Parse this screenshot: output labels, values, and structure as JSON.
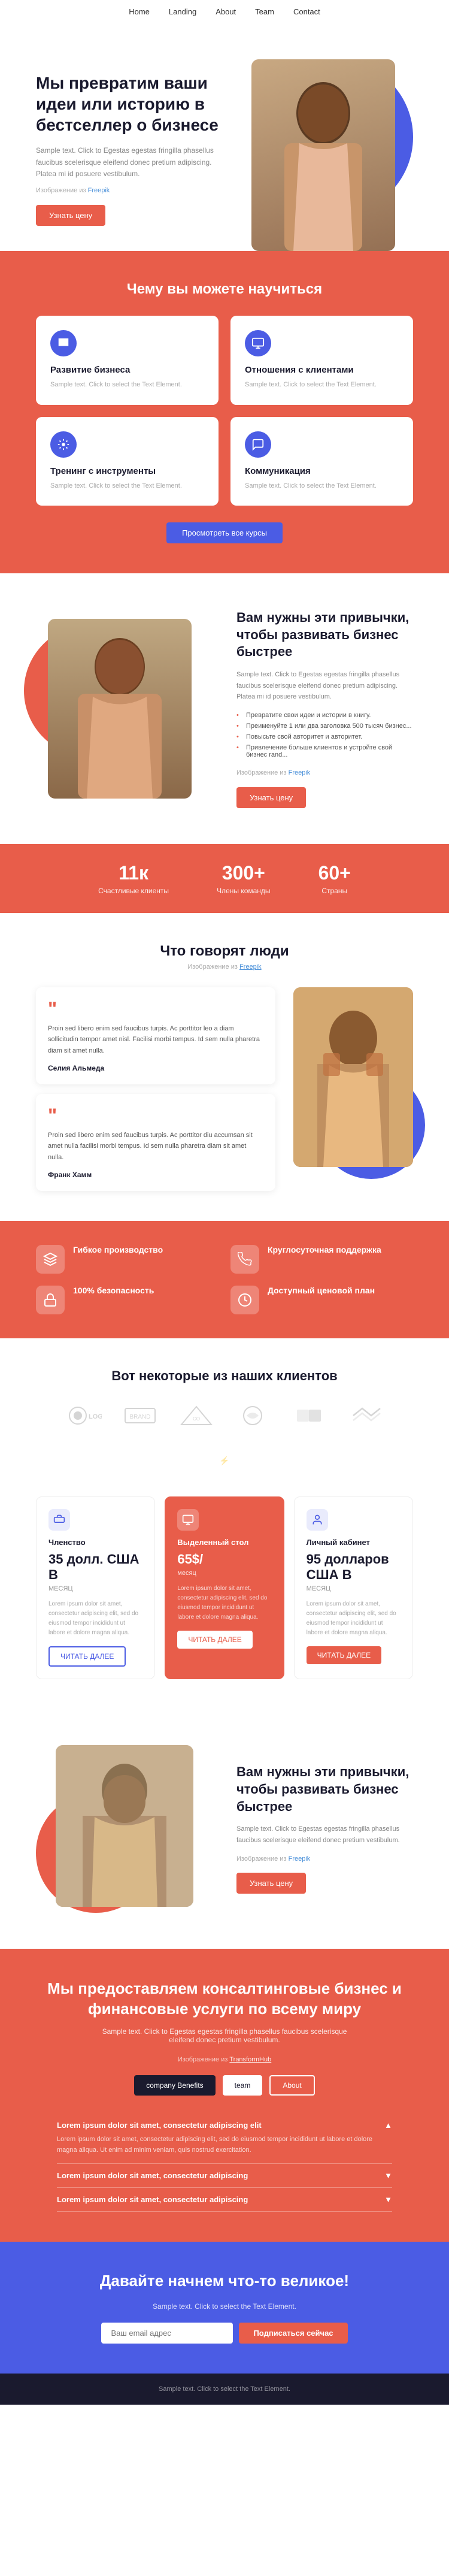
{
  "nav": {
    "links": [
      "Home",
      "Landing",
      "About",
      "Team",
      "Contact"
    ]
  },
  "hero": {
    "title": "Мы превратим ваши идеи или историю в бестселлер о бизнесе",
    "body": "Sample text. Click to Egestas egestas fringilla phasellus faucibus scelerisque eleifend donec pretium adipiscing. Platea mi id posuere vestibulum.",
    "img_credit": "Изображение из ",
    "img_credit_link": "Freepik",
    "btn_label": "Узнать цену"
  },
  "learn": {
    "title": "Чему вы можете научиться",
    "cards": [
      {
        "title": "Развитие бизнеса",
        "body": "Sample text. Click to select the Text Element."
      },
      {
        "title": "Отношения с клиентами",
        "body": "Sample text. Click to select the Text Element."
      },
      {
        "title": "Тренинг с инструменты",
        "body": "Sample text. Click to select the Text Element."
      },
      {
        "title": "Коммуникация",
        "body": "Sample text. Click to select the Text Element."
      }
    ],
    "btn_label": "Просмотреть все курсы"
  },
  "habits": {
    "title": "Вам нужны эти привычки, чтобы развивать бизнес быстрее",
    "body": "Sample text. Click to Egestas egestas fringilla phasellus faucibus scelerisque eleifend donec pretium adipiscing. Platea mi id posuere vestibulum.",
    "bullets": [
      "Превратите свои идеи и истории в книгу.",
      "Преименуйте 1 или два заголовка 500 тысяч бизнес...",
      "Повысьте свой авторитет и авторитет.",
      "Привлечение больше клиентов и устройте свой бизнес rand..."
    ],
    "img_credit": "Изображение из ",
    "img_credit_link": "Freepik",
    "btn_label": "Узнать цену"
  },
  "stats": [
    {
      "num": "11к",
      "label": "Счастливые клиенты"
    },
    {
      "num": "300+",
      "label": "Члены команды"
    },
    {
      "num": "60+",
      "label": "Страны"
    }
  ],
  "testimonials": {
    "title": "Что говорят люди",
    "img_credit": "Изображение из ",
    "img_credit_link": "Freepik",
    "items": [
      {
        "quote": "Proin sed libero enim sed faucibus turpis. Ac porttitor leo a diam sollicitudin tempor amet nisl. Facilisi morbi tempus. Id sem nulla pharetra diam sit amet nulla.",
        "author": "Селия Альмеда"
      },
      {
        "quote": "Proin sed libero enim sed faucibus turpis. Ac porttitor diu accumsan sit amet nulla facilisi morbi tempus. Id sem nulla pharetra diam sit amet nulla.",
        "author": "Франк Хамм"
      }
    ]
  },
  "features": [
    {
      "title": "Гибкое производство",
      "body": ""
    },
    {
      "title": "Круглосуточная поддержка",
      "body": ""
    },
    {
      "title": "100% безопасность",
      "body": ""
    },
    {
      "title": "Доступный ценовой план",
      "body": ""
    }
  ],
  "clients": {
    "title": "Вот некоторые из наших клиентов",
    "logos": [
      "logo1",
      "logo2",
      "logo3",
      "logo4",
      "logo5",
      "logo6",
      "logo7"
    ]
  },
  "pricing": {
    "plans": [
      {
        "title": "Членство",
        "price": "35 долл. США В",
        "period": "МЕСЯЦ",
        "body": "Lorem ipsum dolor sit amet, consectetur adipiscing elit, sed do eiusmod tempor incididunt ut labore et dolore magna aliqua.",
        "btn": "ЧИТАТЬ ДАЛЕЕ",
        "featured": false
      },
      {
        "title": "Выделенный стол",
        "price": "65$/",
        "period": "месяц",
        "body": "Lorem ipsum dolor sit amet, consectetur adipiscing elit, sed do eiusmod tempor incididunt ut labore et dolore magna aliqua.",
        "btn": "ЧИТАТЬ ДАЛЕЕ",
        "featured": true
      },
      {
        "title": "Личный кабинет",
        "price": "95 долларов США В",
        "period": "МЕСЯЦ",
        "body": "Lorem ipsum dolor sit amet, consectetur adipiscing elit, sed do eiusmod tempor incididunt ut labore et dolore magna aliqua.",
        "btn": "ЧИТАТЬ ДАЛЕЕ",
        "featured": false
      }
    ]
  },
  "habits2": {
    "title": "Вам нужны эти привычки, чтобы развивать бизнес быстрее",
    "body": "Sample text. Click to Egestas egestas fringilla phasellus faucibus scelerisque eleifend donec pretium vestibulum.",
    "img_credit": "Изображение из ",
    "img_credit_link": "Freepik",
    "btn_label": "Узнать цену"
  },
  "consulting": {
    "title": "Мы предоставляем консалтинговые бизнес и финансовые услуги по всему миру",
    "body": "Sample text. Click to Egestas egestas fringilla phasellus faucibus scelerisque eleifend donec pretium vestibulum.",
    "img_credit": "Изображение из ",
    "img_credit_link": "TransformHub",
    "btn1": "company Benefits",
    "btn2": "team",
    "btn3": "About",
    "acc_items": [
      {
        "title": "Lorem ipsum dolor sit amet, consectetur adipiscing elit",
        "body": "Lorem ipsum dolor sit amet, consectetur adipiscing elit, sed do eiusmod tempor incididunt ut labore et dolore magna aliqua. Ut enim ad minim veniam, quis nostrud exercitation."
      },
      {
        "title": "Lorem ipsum dolor sit amet, consectetur adipiscing",
        "body": ""
      },
      {
        "title": "Lorem ipsum dolor sit amet, consectetur adipiscing",
        "body": ""
      }
    ]
  },
  "cta": {
    "title": "Давайте начнем что-то великое!",
    "body": "Sample text. Click to select the Text Element.",
    "input_placeholder": "Ваш email адрес",
    "btn_label": "Подписаться сейчас"
  },
  "footer": {
    "text": "Sample text. Click to select the Text Element."
  }
}
